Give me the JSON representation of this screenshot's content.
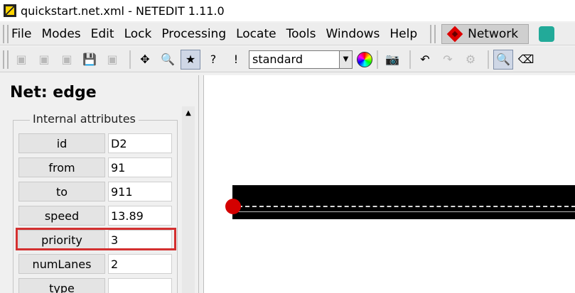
{
  "window": {
    "title": "quickstart.net.xml - NETEDIT 1.11.0"
  },
  "menu": {
    "items": [
      {
        "key": "file",
        "label": "File"
      },
      {
        "key": "modes",
        "label": "Modes"
      },
      {
        "key": "edit",
        "label": "Edit"
      },
      {
        "key": "lock",
        "label": "Lock"
      },
      {
        "key": "processing",
        "label": "Processing"
      },
      {
        "key": "locate",
        "label": "Locate"
      },
      {
        "key": "tools",
        "label": "Tools"
      },
      {
        "key": "windows",
        "label": "Windows"
      },
      {
        "key": "help",
        "label": "Help"
      }
    ],
    "network_button": "Network"
  },
  "toolbar": {
    "scheme_select": "standard"
  },
  "panel": {
    "title": "Net: edge",
    "group_title": "Internal attributes",
    "attributes": [
      {
        "name": "id",
        "value": "D2"
      },
      {
        "name": "from",
        "value": "91"
      },
      {
        "name": "to",
        "value": "911"
      },
      {
        "name": "speed",
        "value": "13.89"
      },
      {
        "name": "priority",
        "value": "3"
      },
      {
        "name": "numLanes",
        "value": "2"
      },
      {
        "name": "type",
        "value": ""
      }
    ],
    "highlighted_attribute": "priority"
  },
  "colors": {
    "highlight": "#d32f2f",
    "junction": "#d40000",
    "road": "#000000"
  }
}
